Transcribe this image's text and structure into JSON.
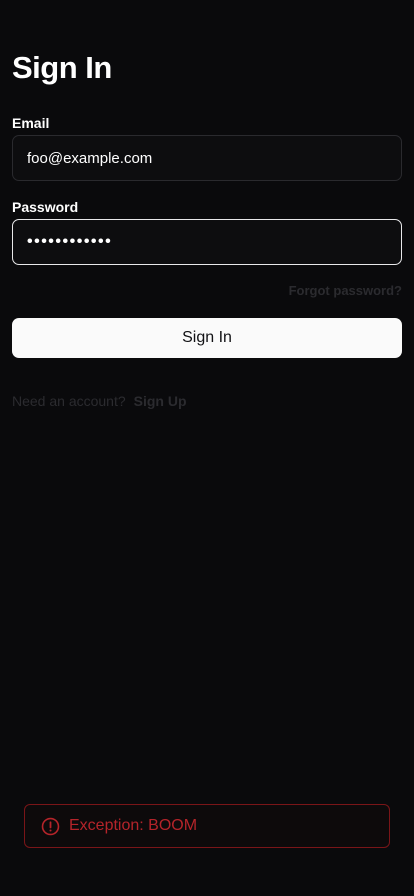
{
  "title": "Sign In",
  "form": {
    "email_label": "Email",
    "email_value": "foo@example.com",
    "password_label": "Password",
    "password_value": "••••••••••••",
    "forgot_password": "Forgot password?",
    "submit_label": "Sign In"
  },
  "footer": {
    "prompt": "Need an account?",
    "signup_link": "Sign Up"
  },
  "toast": {
    "icon": "alert-circle-icon",
    "message": "Exception: BOOM",
    "color": "#b5242a"
  },
  "colors": {
    "background": "#0a0a0c",
    "primary_button": "#fafafa",
    "error": "#b5242a"
  }
}
